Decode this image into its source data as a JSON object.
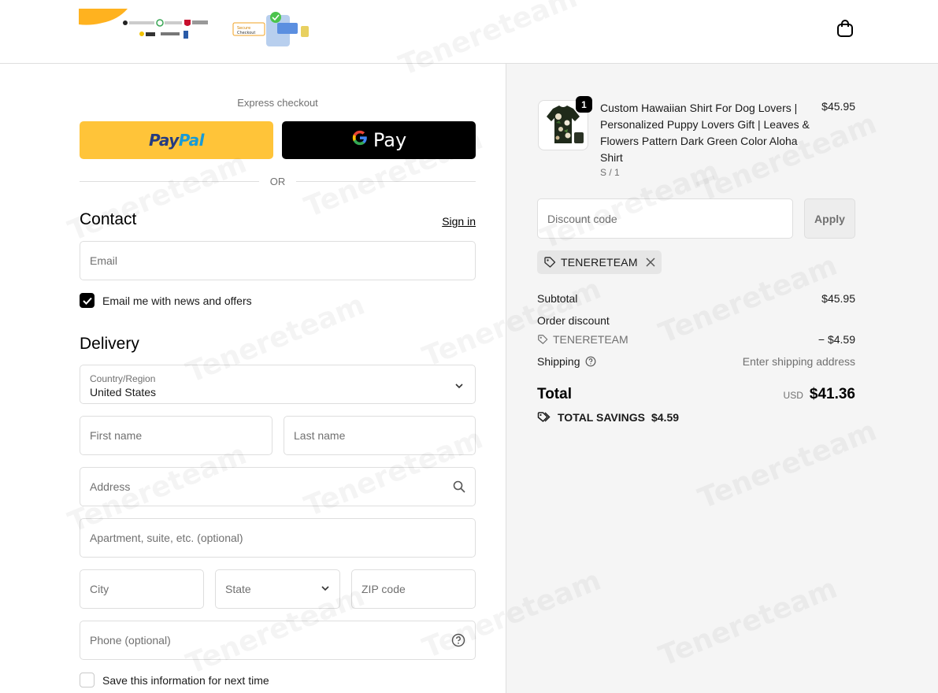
{
  "header": {
    "logo_text": "Secure Checkout",
    "cart_icon": "shopping-bag-icon"
  },
  "express": {
    "label": "Express checkout",
    "paypal_label_1": "Pay",
    "paypal_label_2": "Pal",
    "gpay_g": "G",
    "gpay_label": "Pay",
    "or_label": "OR"
  },
  "contact": {
    "title": "Contact",
    "sign_in": "Sign in",
    "email_placeholder": "Email",
    "news_label": "Email me with news and offers",
    "news_checked": true
  },
  "delivery": {
    "title": "Delivery",
    "country_label": "Country/Region",
    "country_value": "United States",
    "first_name_placeholder": "First name",
    "last_name_placeholder": "Last name",
    "address_placeholder": "Address",
    "apartment_placeholder": "Apartment, suite, etc. (optional)",
    "city_placeholder": "City",
    "state_label": "State",
    "zip_placeholder": "ZIP code",
    "phone_placeholder": "Phone (optional)",
    "save_label": "Save this information for next time",
    "save_checked": false
  },
  "order": {
    "product_name": "Custom Hawaiian Shirt For Dog Lovers | Personalized Puppy Lovers Gift | Leaves & Flowers Pattern Dark Green Color Aloha Shirt",
    "variant": "S / 1",
    "quantity": "1",
    "price": "$45.95",
    "discount_placeholder": "Discount code",
    "apply_label": "Apply",
    "applied_code": "TENERETEAM",
    "subtotal_label": "Subtotal",
    "subtotal_value": "$45.95",
    "order_discount_label": "Order discount",
    "discount_code": "TENERETEAM",
    "discount_value": "− $4.59",
    "shipping_label": "Shipping",
    "shipping_value": "Enter shipping address",
    "total_label": "Total",
    "currency": "USD",
    "total_value": "$41.36",
    "savings_label": "TOTAL SAVINGS",
    "savings_value": "$4.59"
  },
  "colors": {
    "paypal_yellow": "#ffc439",
    "paypal_dark": "#253b80",
    "paypal_light": "#179bd7",
    "gpay_black": "#000000",
    "checkbox_black": "#000000",
    "summary_bg": "#f5f5f5"
  }
}
